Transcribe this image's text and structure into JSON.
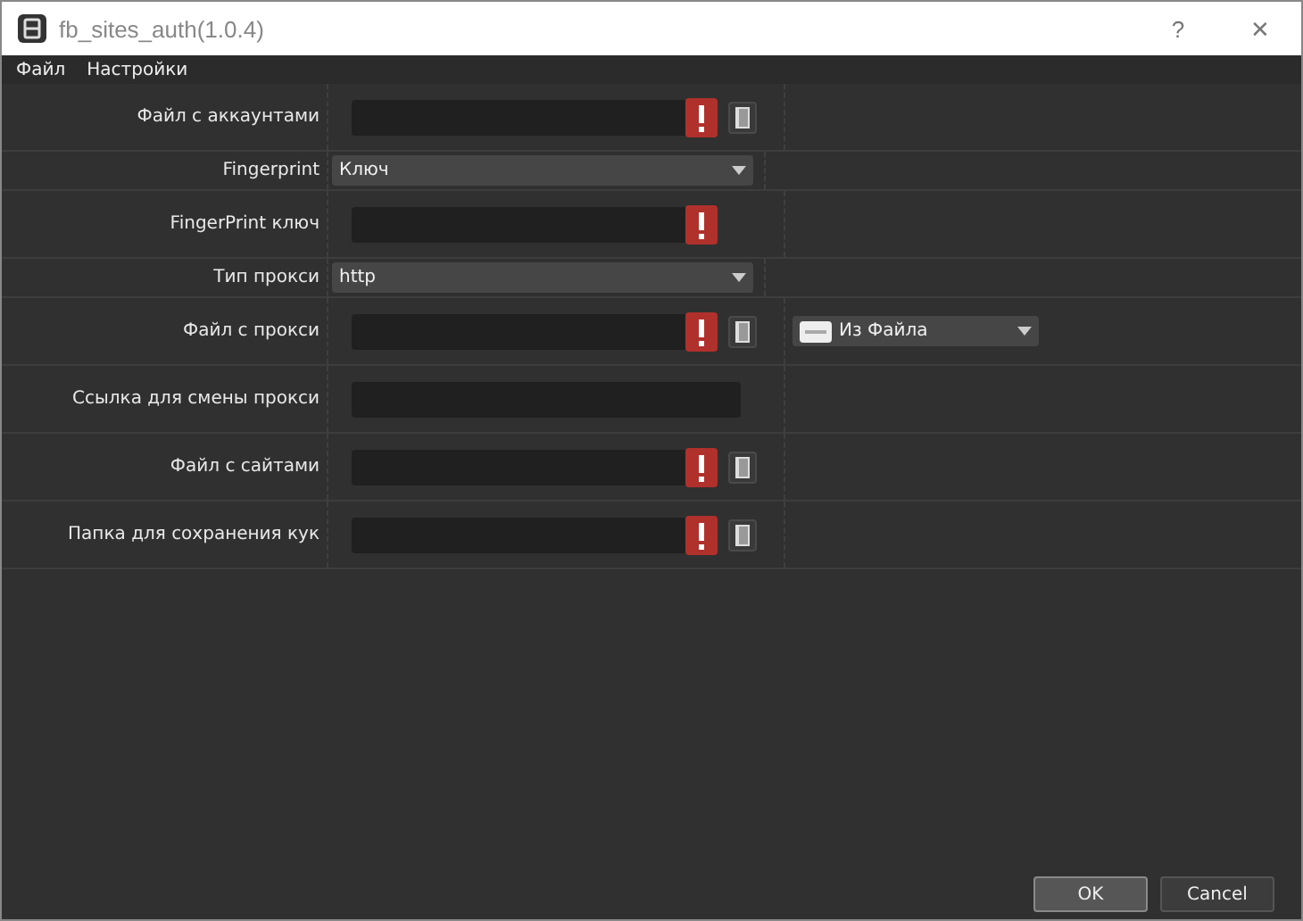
{
  "window": {
    "title": "fb_sites_auth(1.0.4)",
    "help": "?",
    "close": "✕"
  },
  "menu": [
    "Файл",
    "Настройки"
  ],
  "rows": [
    {
      "label": "Файл с аккаунтами",
      "kind": "field",
      "error": true,
      "browse": true
    },
    {
      "label": "Fingerprint",
      "kind": "select",
      "value": "Ключ"
    },
    {
      "label": "FingerPrint ключ",
      "kind": "field",
      "error": true,
      "browse": false
    },
    {
      "label": "Тип прокси",
      "kind": "select",
      "value": "http"
    },
    {
      "label": "Файл с прокси",
      "kind": "field",
      "error": true,
      "browse": true,
      "extra": {
        "value": "Из Файла"
      }
    },
    {
      "label": "Ссылка для смены прокси",
      "kind": "field",
      "error": false,
      "browse": false
    },
    {
      "label": "Файл с сайтами",
      "kind": "field",
      "error": true,
      "browse": true
    },
    {
      "label": "Папка для сохранения кук",
      "kind": "field",
      "error": true,
      "browse": true
    }
  ],
  "buttons": [
    {
      "label": "OK",
      "selected": true
    },
    {
      "label": "Cancel",
      "selected": false
    }
  ]
}
